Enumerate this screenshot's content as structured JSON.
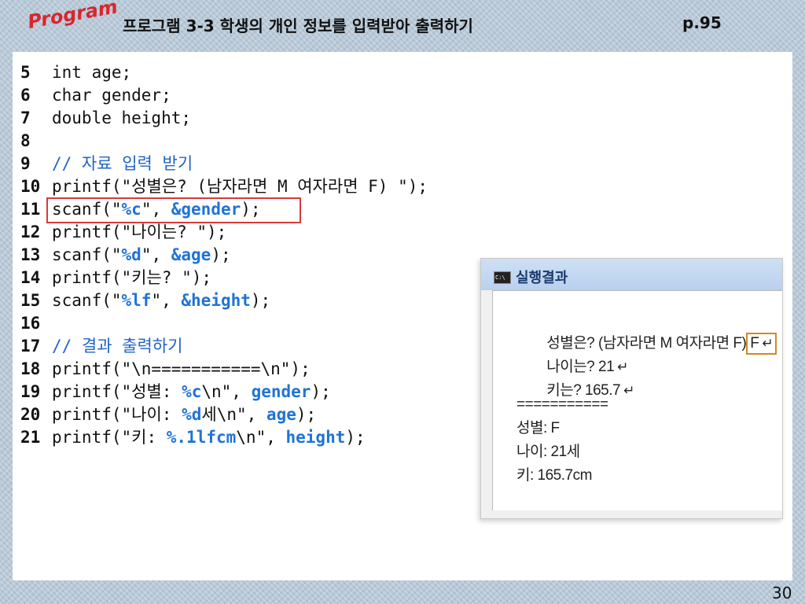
{
  "header": {
    "program_label": "Program",
    "title": "프로그램 3-3   학생의 개인 정보를 입력받아 출력하기",
    "page_ref": "p.95"
  },
  "code": {
    "lines": [
      {
        "num": "5",
        "parts": [
          "int age;"
        ]
      },
      {
        "num": "6",
        "parts": [
          "char gender;"
        ]
      },
      {
        "num": "7",
        "parts": [
          "double height;"
        ]
      },
      {
        "num": "8",
        "parts": [
          ""
        ]
      },
      {
        "num": "9",
        "parts": [
          "// 자료 입력 받기"
        ]
      },
      {
        "num": "10",
        "parts": [
          "printf(\"성별은? (남자라면 M 여자라면 F) \");"
        ]
      },
      {
        "num": "11",
        "parts": [
          "scanf(\"",
          "%c",
          "\", ",
          "&gender",
          ");"
        ]
      },
      {
        "num": "12",
        "parts": [
          "printf(\"나이는? \");"
        ]
      },
      {
        "num": "13",
        "parts": [
          "scanf(\"",
          "%d",
          "\", ",
          "&age",
          ");"
        ]
      },
      {
        "num": "14",
        "parts": [
          "printf(\"키는? \");"
        ]
      },
      {
        "num": "15",
        "parts": [
          "scanf(\"",
          "%lf",
          "\", ",
          "&height",
          ");"
        ]
      },
      {
        "num": "16",
        "parts": [
          ""
        ]
      },
      {
        "num": "17",
        "parts": [
          "// 결과 출력하기"
        ]
      },
      {
        "num": "18",
        "parts": [
          "printf(\"\\n===========\\n\");"
        ]
      },
      {
        "num": "19",
        "parts": [
          "printf(\"성별: ",
          "%c",
          "\\n\", ",
          "gender",
          ");"
        ]
      },
      {
        "num": "20",
        "parts": [
          "printf(\"나이: ",
          "%d",
          "세\\n\", ",
          "age",
          ");"
        ]
      },
      {
        "num": "21",
        "parts": [
          "printf(\"키: ",
          "%.1lfcm",
          "\\n\", ",
          "height",
          ");"
        ]
      }
    ]
  },
  "result": {
    "title": "실행결과",
    "icon_label": "C:\\",
    "lines": [
      {
        "prompt": "성별은? (남자라면 M 여자라면 F)",
        "answer": "F",
        "enter": "↵"
      },
      {
        "prompt": "나이는? 21",
        "answer": "",
        "enter": "↵"
      },
      {
        "prompt": "키는? 165.7",
        "answer": "",
        "enter": "↵"
      }
    ],
    "separator": "===========",
    "output": [
      "성별: F",
      "나이: 21세",
      "키: 165.7cm"
    ]
  },
  "page_number": "30",
  "colors": {
    "keyword": "#1f73d6",
    "comment": "#1f63c7",
    "highlight_red": "#d73b3b",
    "answer_box": "#d08a1d",
    "program_label": "#d8262c"
  }
}
